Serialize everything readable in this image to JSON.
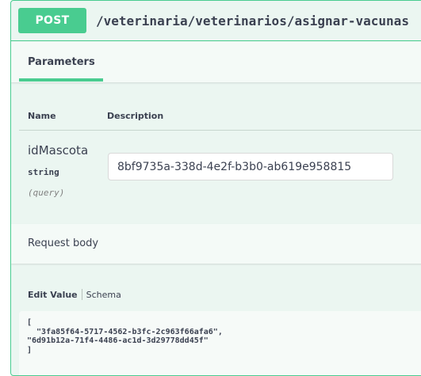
{
  "operation": {
    "method": "POST",
    "path": "/veterinaria/veterinarios/asignar-vacunas"
  },
  "tabs": {
    "parameters": "Parameters"
  },
  "parameters_table": {
    "col_name": "Name",
    "col_description": "Description",
    "param": {
      "name": "idMascota",
      "type": "string",
      "in": "(query)",
      "value": "8bf9735a-338d-4e2f-b3b0-ab619e958815"
    }
  },
  "request_body": {
    "title": "Request body",
    "edit_value_label": "Edit Value",
    "schema_label": "Schema",
    "json_text": "[\n  \"3fa85f64-5717-4562-b3fc-2c963f66afa6\",\n\"6d91b12a-71f4-4486-ac1d-3d29778dd45f\"\n]"
  },
  "colors": {
    "accent": "#49cc90",
    "panel_bg": "#ebf6f1",
    "text": "#3b4151"
  }
}
